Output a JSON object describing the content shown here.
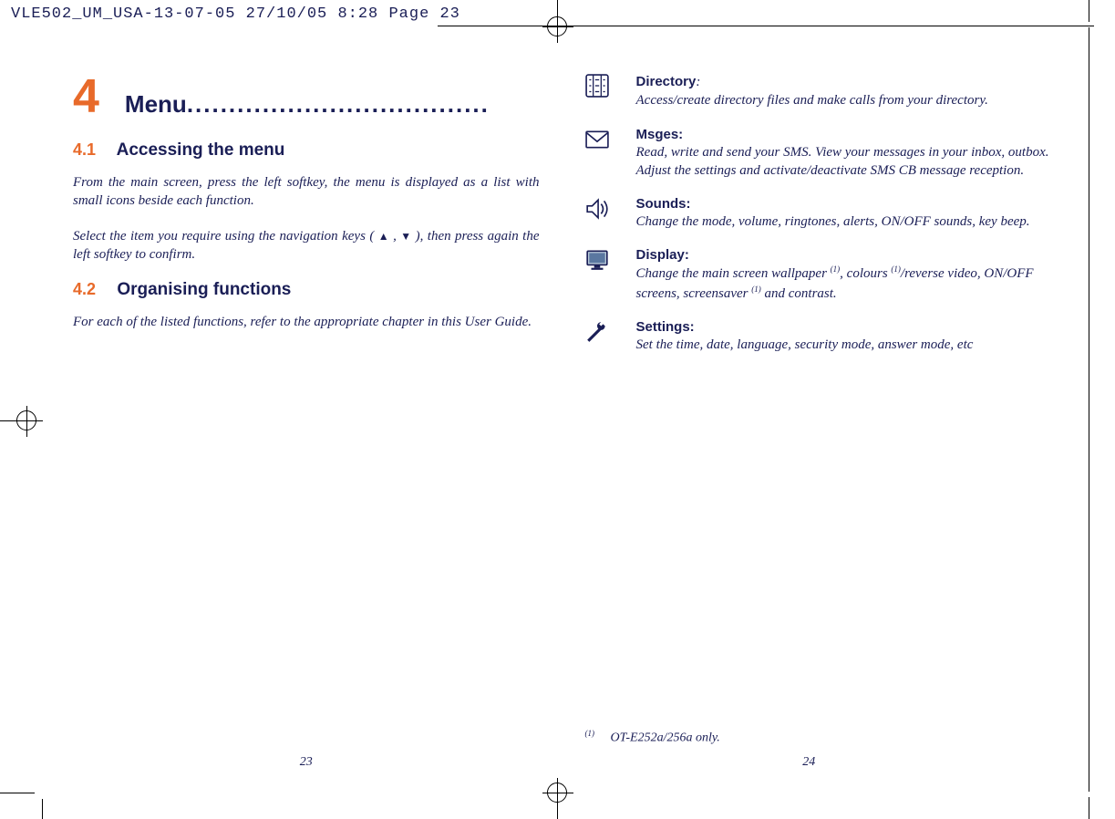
{
  "header": "VLE502_UM_USA-13-07-05  27/10/05  8:28  Page 23",
  "left": {
    "chapter_number": "4",
    "chapter_title": "Menu ",
    "dots": "....................................",
    "s1_num": "4.1",
    "s1_title": "Accessing the menu",
    "p1": "From the main screen, press the left softkey, the menu is displayed as a list with small icons beside each function.",
    "p2a": "Select the item you require using the navigation keys ( ",
    "p2b": " , ",
    "p2c": " ), then press again the left softkey to confirm.",
    "s2_num": "4.2",
    "s2_title": "Organising functions",
    "p3": "For each of the listed functions, refer to the appropriate chapter in this User Guide.",
    "page_number": "23"
  },
  "right": {
    "items": [
      {
        "title": "Directory",
        "colon": ":",
        "desc": "Access/create directory files and make calls from your directory."
      },
      {
        "title": "Msges:",
        "colon": "",
        "desc": "Read, write and send your SMS. View your messages in your inbox, outbox. Adjust the settings and activate/deactivate SMS CB message reception."
      },
      {
        "title": "Sounds:",
        "colon": "",
        "desc": "Change the mode, volume, ringtones, alerts, ON/OFF sounds, key beep."
      },
      {
        "title": "Display:",
        "colon": "",
        "desc_parts": [
          "Change the main screen wallpaper ",
          ", colours ",
          "/reverse video, ON/OFF screens, screensaver ",
          " and contrast."
        ],
        "sup": "(1)"
      },
      {
        "title": "Settings:",
        "colon": "",
        "desc": "Set the time, date, language, security mode, answer mode, etc"
      }
    ],
    "footnote_sup": "(1)",
    "footnote_text": "OT-E252a/256a only.",
    "page_number": "24"
  }
}
